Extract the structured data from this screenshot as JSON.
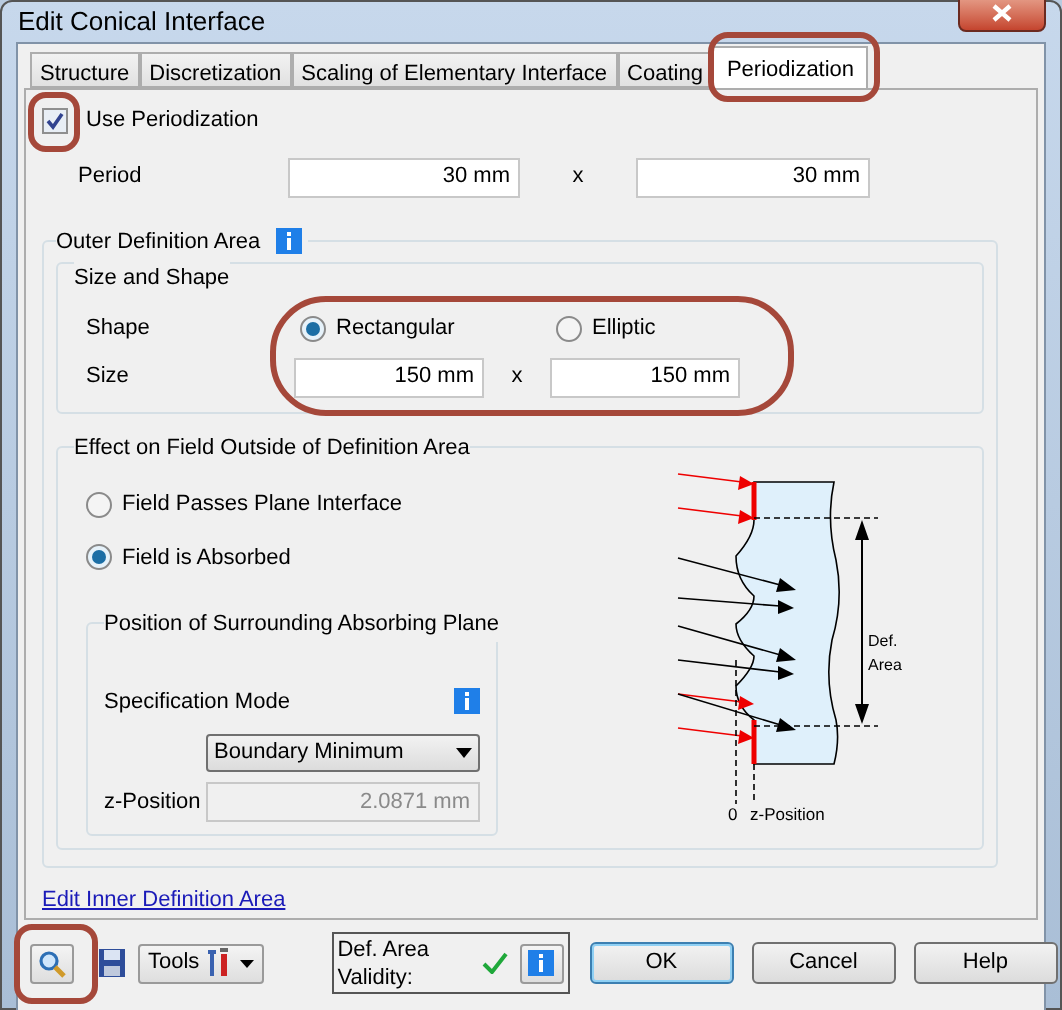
{
  "window": {
    "title": "Edit Conical Interface"
  },
  "tabs": [
    {
      "label": "Structure",
      "selected": false
    },
    {
      "label": "Discretization",
      "selected": false
    },
    {
      "label": "Scaling of Elementary Interface",
      "selected": false
    },
    {
      "label": "Coating",
      "selected": false
    },
    {
      "label": "Periodization",
      "selected": true
    }
  ],
  "use_periodization": {
    "label": "Use Periodization",
    "checked": true
  },
  "period": {
    "label": "Period",
    "x_value": "30 mm",
    "separator": "x",
    "y_value": "30 mm"
  },
  "outer_definition_area": {
    "title": "Outer Definition Area",
    "size_and_shape": {
      "title": "Size and Shape",
      "shape_label": "Shape",
      "shape_options": [
        {
          "label": "Rectangular",
          "selected": true
        },
        {
          "label": "Elliptic",
          "selected": false
        }
      ],
      "size_label": "Size",
      "size_x": "150 mm",
      "separator": "x",
      "size_y": "150 mm"
    },
    "effect": {
      "title": "Effect on Field Outside of Definition Area",
      "options": [
        {
          "label": "Field Passes Plane Interface",
          "selected": false
        },
        {
          "label": "Field is Absorbed",
          "selected": true
        }
      ],
      "absorbing_plane": {
        "title": "Position of Surrounding Absorbing Plane",
        "specification_mode_label": "Specification Mode",
        "specification_mode": "Boundary Minimum",
        "z_position_label": "z-Position",
        "z_position": "2.0871 mm",
        "z_position_disabled": true
      },
      "diagram": {
        "area_label": [
          "Def.",
          "Area"
        ],
        "zero_label": "0",
        "z_label": "z-Position"
      }
    }
  },
  "inner_link": "Edit Inner Definition Area",
  "toolbar": {
    "tools_label": "Tools",
    "validity_label": "Def. Area Validity:",
    "valid": true
  },
  "buttons": [
    {
      "label": "OK",
      "default": true
    },
    {
      "label": "Cancel",
      "default": false
    },
    {
      "label": "Help",
      "default": false
    }
  ]
}
